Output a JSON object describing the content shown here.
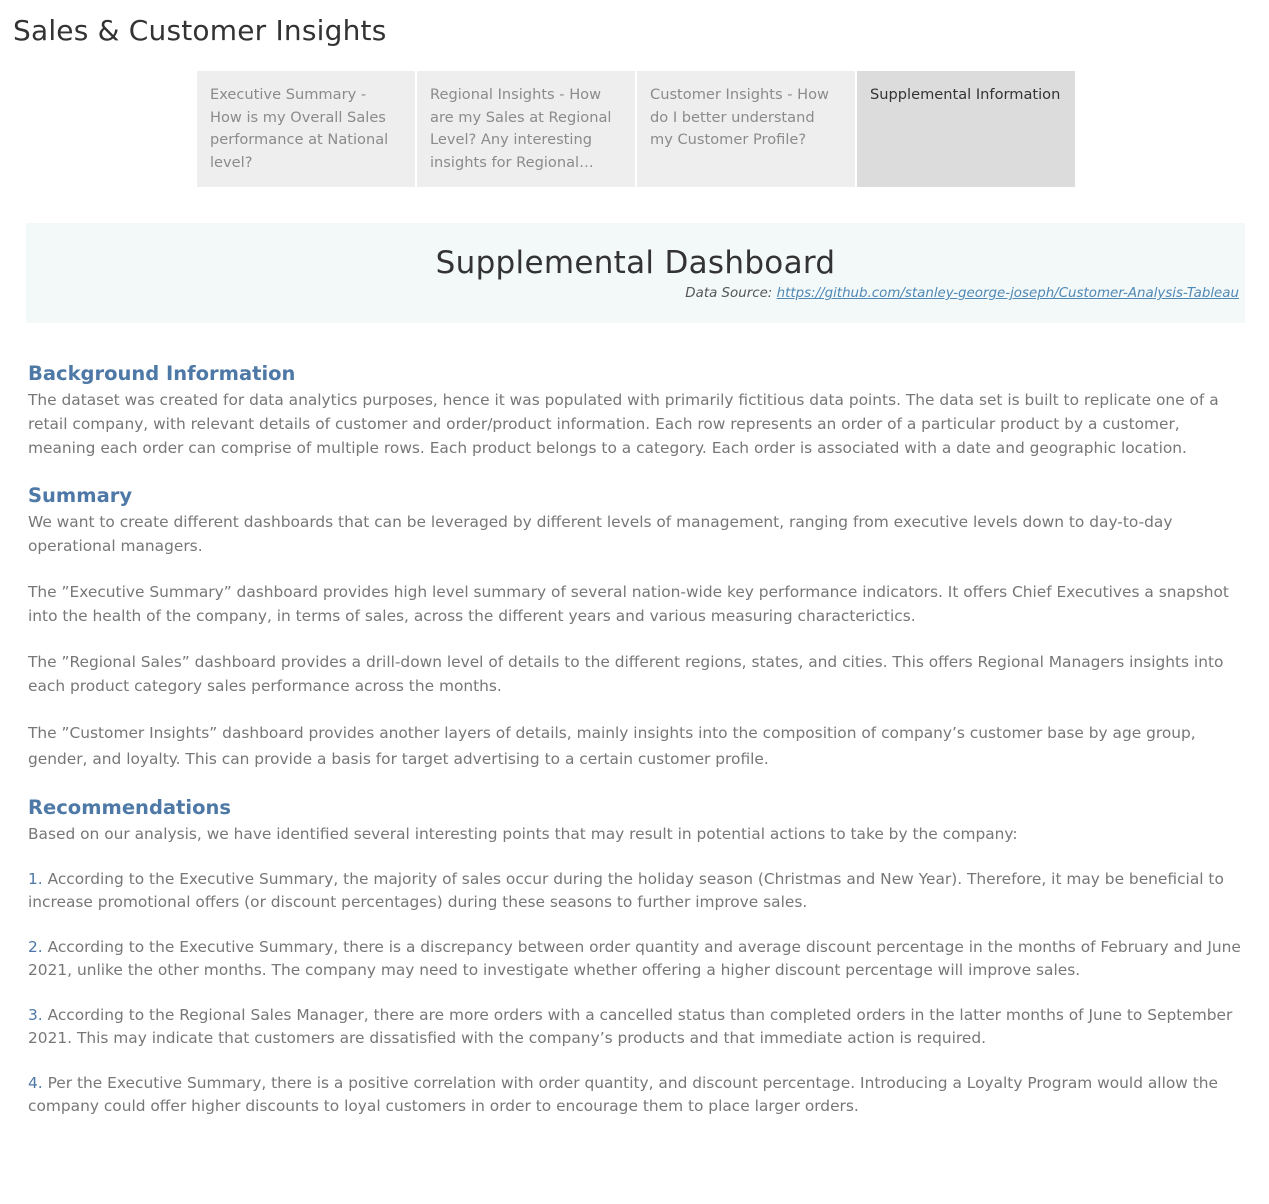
{
  "workbook": {
    "title": "Sales & Customer Insights"
  },
  "tabs": [
    {
      "label": "Executive Summary - How is my Overall Sales performance at National level?",
      "active": false
    },
    {
      "label": "Regional Insights - How are my Sales at Regional Level? Any interesting insights for Regional Sales Manag..",
      "active": false
    },
    {
      "label": "Customer Insights - How do I better understand my Customer Profile?",
      "active": false
    },
    {
      "label": "Supplemental Information",
      "active": true
    }
  ],
  "header": {
    "title": "Supplemental Dashboard",
    "data_source_label": "Data Source:",
    "data_source_url": "https://github.com/stanley-george-joseph/Customer-Analysis-Tableau"
  },
  "background": {
    "title": "Background Information",
    "text": "The dataset was created for data analytics purposes, hence it was populated with primarily fictitious data points. The data set is built to replicate one of a retail company, with relevant details of customer and order/product information. Each row represents an order of a particular product by a customer, meaning each order can comprise of multiple rows. Each product belongs to a category. Each order is associated with a date and geographic location."
  },
  "summary": {
    "title": "Summary",
    "paragraphs": [
      "We want to create different dashboards that can be leveraged by different levels of management, ranging from executive levels down to day-to-day operational managers.",
      "The ”Executive Summary” dashboard provides high level summary of several nation-wide key performance indicators. It offers Chief Executives a snapshot into the health of the company, in terms of sales, across the different years and various measuring characterictics.",
      "The ”Regional Sales” dashboard provides a drill-down level of details to the different regions, states, and cities. This offers Regional Managers insights into each product category sales performance across the months.",
      "The ”Customer Insights” dashboard provides another layers of details, mainly insights into the composition of company’s customer base by age group, gender, and loyalty. This can provide a basis for target advertising to a certain customer profile."
    ]
  },
  "recommendations": {
    "title": "Recommendations",
    "intro": "Based on our analysis, we have identified several interesting points that may result in potential actions to take by the company:",
    "items": [
      {
        "num": "1.",
        "text": " According to the Executive Summary, the majority of sales occur during the holiday season (Christmas and New Year). Therefore, it may be beneficial to increase promotional offers (or discount percentages) during these seasons to further improve sales."
      },
      {
        "num": "2.",
        "text": " According to the Executive Summary, there is a discrepancy between order quantity and average discount percentage in the months of February and June 2021, unlike the other months. The company may need to investigate whether offering a higher discount percentage will improve sales."
      },
      {
        "num": "3.",
        "text": " According to the Regional Sales Manager, there are more orders with a cancelled status than completed orders in the latter months of June to September 2021. This may indicate that customers are dissatisfied with the company’s products and that immediate action is required."
      },
      {
        "num": "4.",
        "text": " Per the Executive Summary, there is a positive correlation with order quantity, and discount percentage. Introducing a Loyalty Program would allow the company could offer higher discounts to loyal customers in order to encourage them to place larger orders."
      }
    ]
  }
}
